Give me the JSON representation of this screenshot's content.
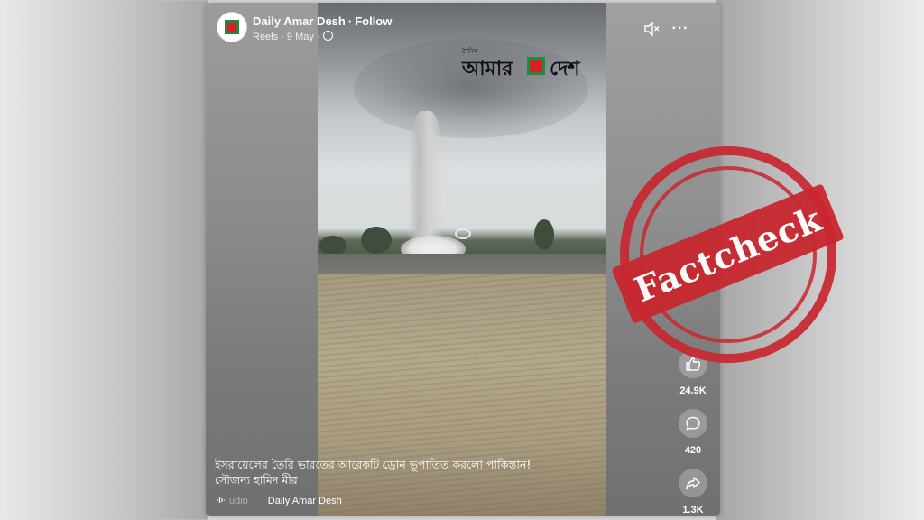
{
  "post": {
    "page_name": "Daily Amar Desh",
    "follow_label": "Follow",
    "dot": "·",
    "meta": "Reels · 9 May ·"
  },
  "video": {
    "watermark_small": "দৈনিক",
    "watermark_left": "আমার",
    "watermark_right": "দেশ"
  },
  "caption": {
    "line1": "ইসরায়েলের তৈরি ভারতের আরেকটি ড্রোন ভূপাতিত করলো পাকিস্তান!",
    "line2": "সৌজন্য হামিদ মীর"
  },
  "audio": {
    "label": "udio",
    "source": "Daily Amar Desh ·"
  },
  "actions": {
    "likes": "24.9K",
    "comments": "420",
    "shares": "1.3K"
  },
  "stamp": {
    "text": "Factcheck",
    "color": "#c8272f"
  },
  "icons": [
    "page-avatar-icon",
    "globe-icon",
    "mute-icon",
    "more-icon",
    "like-icon",
    "comment-icon",
    "share-icon",
    "audio-icon"
  ]
}
